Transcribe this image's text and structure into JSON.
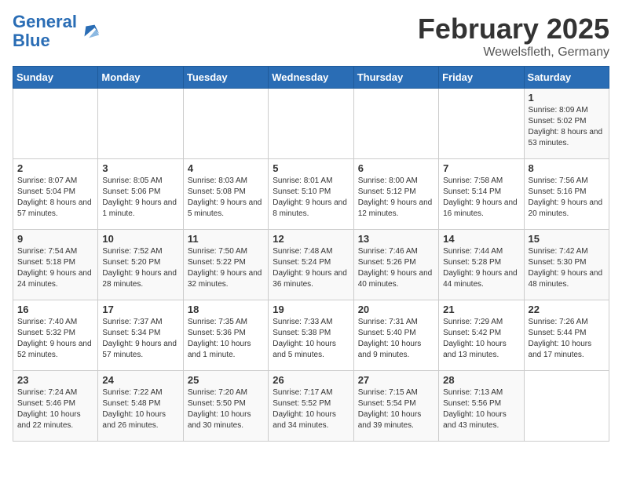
{
  "header": {
    "logo_general": "General",
    "logo_blue": "Blue",
    "month_year": "February 2025",
    "location": "Wewelsfleth, Germany"
  },
  "weekdays": [
    "Sunday",
    "Monday",
    "Tuesday",
    "Wednesday",
    "Thursday",
    "Friday",
    "Saturday"
  ],
  "weeks": [
    [
      {
        "day": "",
        "info": ""
      },
      {
        "day": "",
        "info": ""
      },
      {
        "day": "",
        "info": ""
      },
      {
        "day": "",
        "info": ""
      },
      {
        "day": "",
        "info": ""
      },
      {
        "day": "",
        "info": ""
      },
      {
        "day": "1",
        "info": "Sunrise: 8:09 AM\nSunset: 5:02 PM\nDaylight: 8 hours and 53 minutes."
      }
    ],
    [
      {
        "day": "2",
        "info": "Sunrise: 8:07 AM\nSunset: 5:04 PM\nDaylight: 8 hours and 57 minutes."
      },
      {
        "day": "3",
        "info": "Sunrise: 8:05 AM\nSunset: 5:06 PM\nDaylight: 9 hours and 1 minute."
      },
      {
        "day": "4",
        "info": "Sunrise: 8:03 AM\nSunset: 5:08 PM\nDaylight: 9 hours and 5 minutes."
      },
      {
        "day": "5",
        "info": "Sunrise: 8:01 AM\nSunset: 5:10 PM\nDaylight: 9 hours and 8 minutes."
      },
      {
        "day": "6",
        "info": "Sunrise: 8:00 AM\nSunset: 5:12 PM\nDaylight: 9 hours and 12 minutes."
      },
      {
        "day": "7",
        "info": "Sunrise: 7:58 AM\nSunset: 5:14 PM\nDaylight: 9 hours and 16 minutes."
      },
      {
        "day": "8",
        "info": "Sunrise: 7:56 AM\nSunset: 5:16 PM\nDaylight: 9 hours and 20 minutes."
      }
    ],
    [
      {
        "day": "9",
        "info": "Sunrise: 7:54 AM\nSunset: 5:18 PM\nDaylight: 9 hours and 24 minutes."
      },
      {
        "day": "10",
        "info": "Sunrise: 7:52 AM\nSunset: 5:20 PM\nDaylight: 9 hours and 28 minutes."
      },
      {
        "day": "11",
        "info": "Sunrise: 7:50 AM\nSunset: 5:22 PM\nDaylight: 9 hours and 32 minutes."
      },
      {
        "day": "12",
        "info": "Sunrise: 7:48 AM\nSunset: 5:24 PM\nDaylight: 9 hours and 36 minutes."
      },
      {
        "day": "13",
        "info": "Sunrise: 7:46 AM\nSunset: 5:26 PM\nDaylight: 9 hours and 40 minutes."
      },
      {
        "day": "14",
        "info": "Sunrise: 7:44 AM\nSunset: 5:28 PM\nDaylight: 9 hours and 44 minutes."
      },
      {
        "day": "15",
        "info": "Sunrise: 7:42 AM\nSunset: 5:30 PM\nDaylight: 9 hours and 48 minutes."
      }
    ],
    [
      {
        "day": "16",
        "info": "Sunrise: 7:40 AM\nSunset: 5:32 PM\nDaylight: 9 hours and 52 minutes."
      },
      {
        "day": "17",
        "info": "Sunrise: 7:37 AM\nSunset: 5:34 PM\nDaylight: 9 hours and 57 minutes."
      },
      {
        "day": "18",
        "info": "Sunrise: 7:35 AM\nSunset: 5:36 PM\nDaylight: 10 hours and 1 minute."
      },
      {
        "day": "19",
        "info": "Sunrise: 7:33 AM\nSunset: 5:38 PM\nDaylight: 10 hours and 5 minutes."
      },
      {
        "day": "20",
        "info": "Sunrise: 7:31 AM\nSunset: 5:40 PM\nDaylight: 10 hours and 9 minutes."
      },
      {
        "day": "21",
        "info": "Sunrise: 7:29 AM\nSunset: 5:42 PM\nDaylight: 10 hours and 13 minutes."
      },
      {
        "day": "22",
        "info": "Sunrise: 7:26 AM\nSunset: 5:44 PM\nDaylight: 10 hours and 17 minutes."
      }
    ],
    [
      {
        "day": "23",
        "info": "Sunrise: 7:24 AM\nSunset: 5:46 PM\nDaylight: 10 hours and 22 minutes."
      },
      {
        "day": "24",
        "info": "Sunrise: 7:22 AM\nSunset: 5:48 PM\nDaylight: 10 hours and 26 minutes."
      },
      {
        "day": "25",
        "info": "Sunrise: 7:20 AM\nSunset: 5:50 PM\nDaylight: 10 hours and 30 minutes."
      },
      {
        "day": "26",
        "info": "Sunrise: 7:17 AM\nSunset: 5:52 PM\nDaylight: 10 hours and 34 minutes."
      },
      {
        "day": "27",
        "info": "Sunrise: 7:15 AM\nSunset: 5:54 PM\nDaylight: 10 hours and 39 minutes."
      },
      {
        "day": "28",
        "info": "Sunrise: 7:13 AM\nSunset: 5:56 PM\nDaylight: 10 hours and 43 minutes."
      },
      {
        "day": "",
        "info": ""
      }
    ]
  ]
}
